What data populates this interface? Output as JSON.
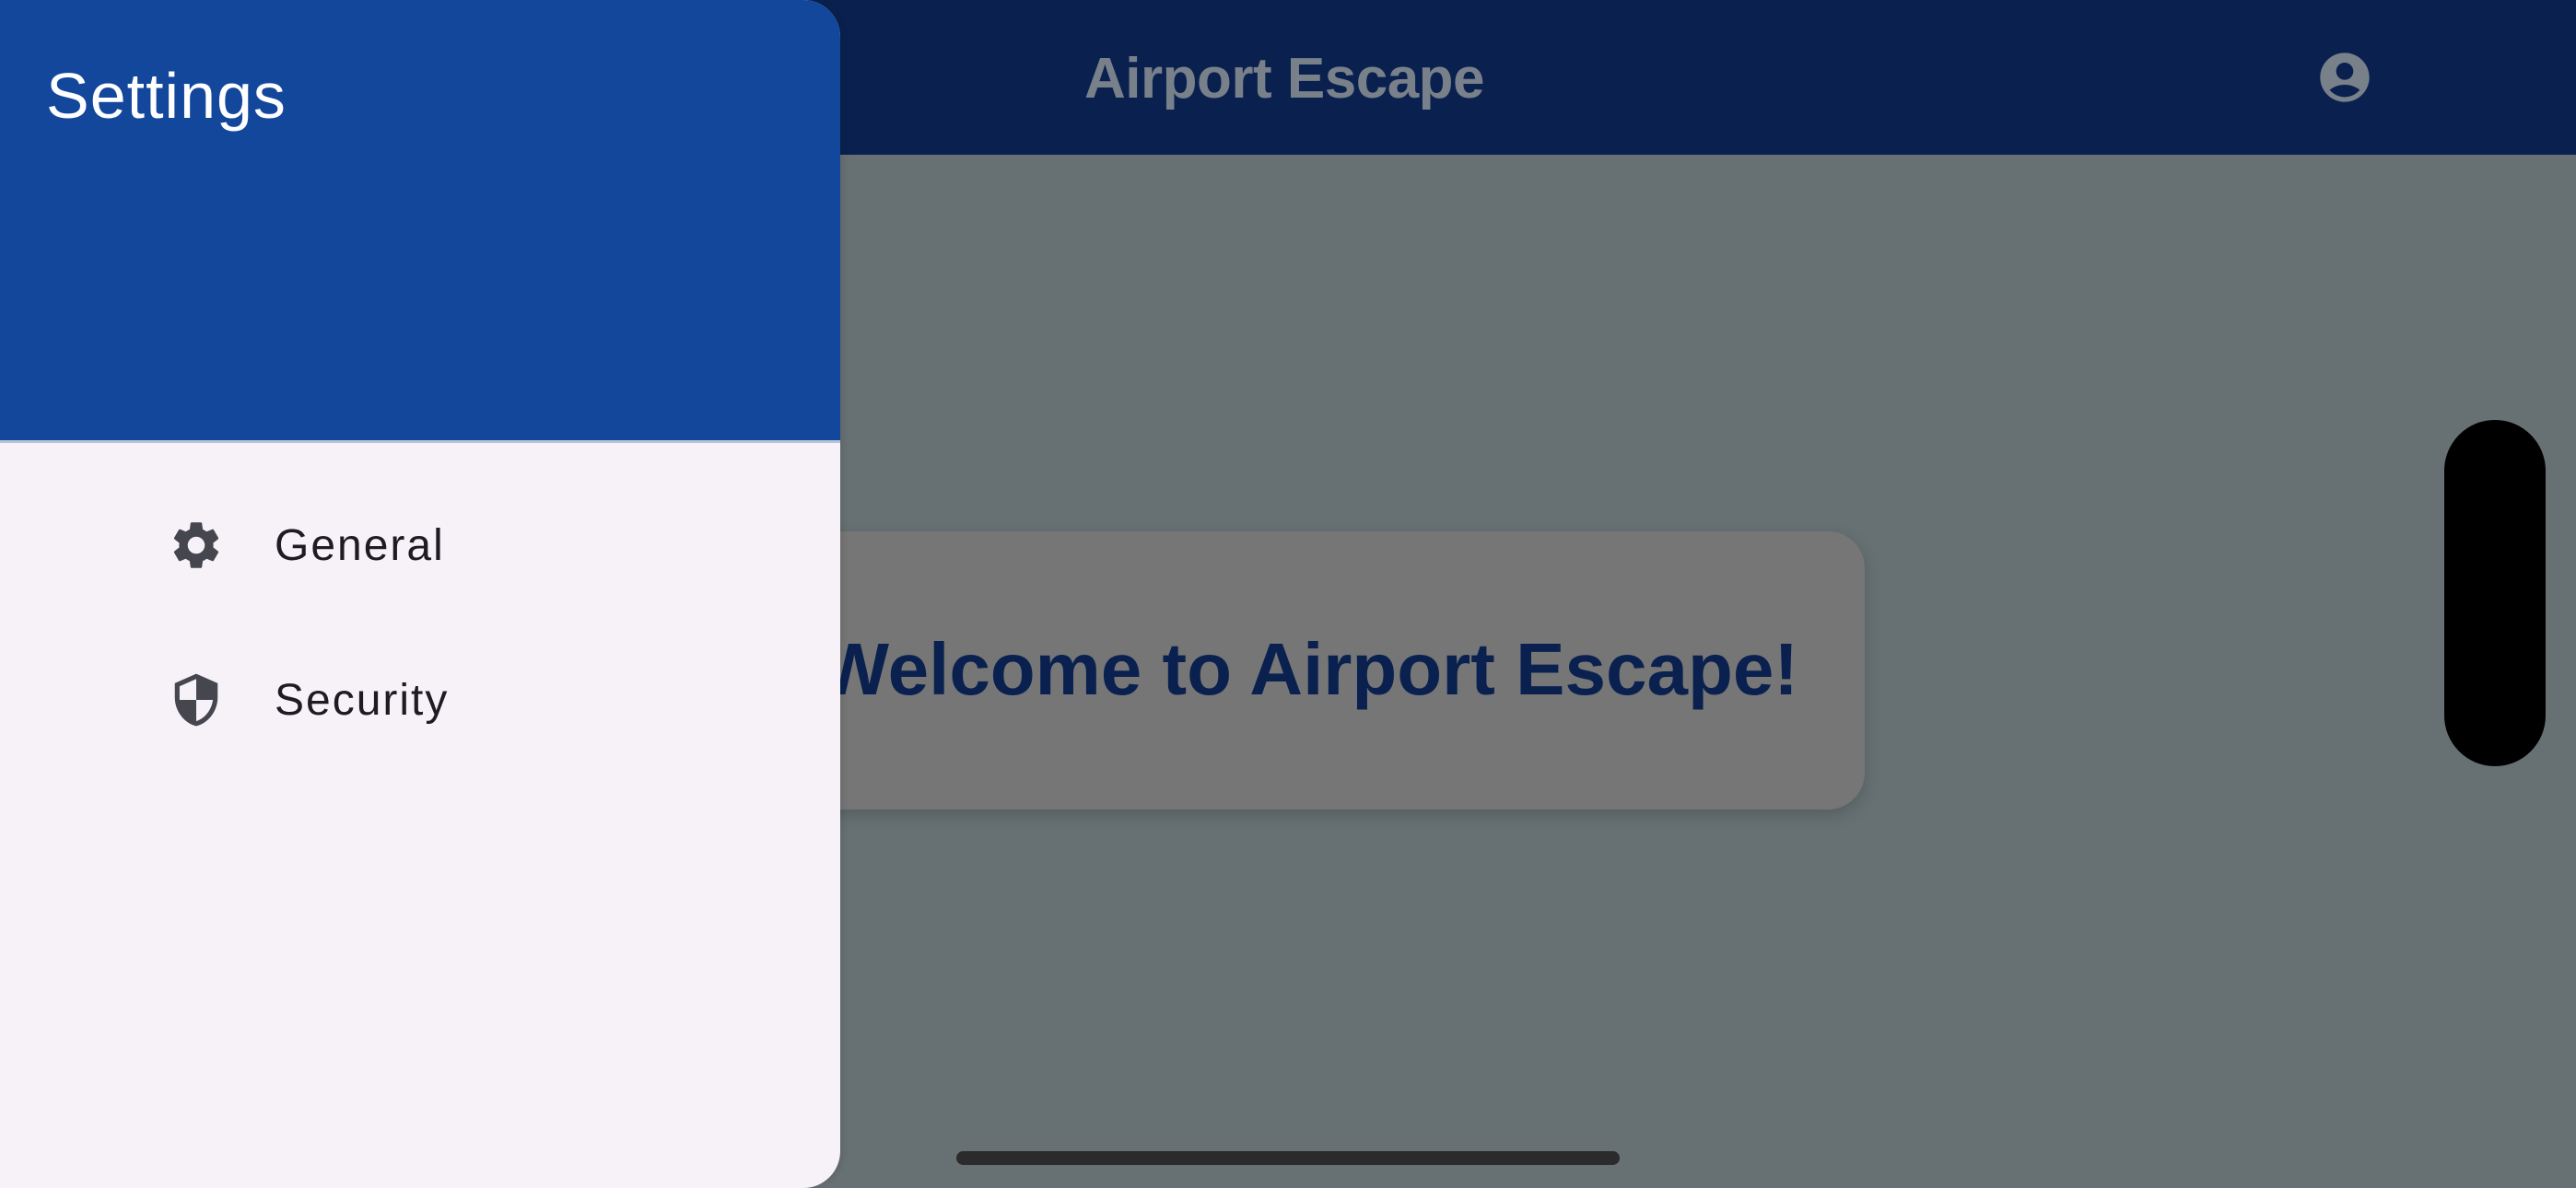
{
  "appbar": {
    "title": "Airport Escape",
    "account_icon": "account-circle-icon",
    "background_color": "#0a2150"
  },
  "main": {
    "welcome_text": "Welcome to Airport Escape!"
  },
  "drawer": {
    "title": "Settings",
    "header_color": "#13479c",
    "items": [
      {
        "label": "General",
        "icon": "gear-icon"
      },
      {
        "label": "Security",
        "icon": "shield-icon"
      }
    ]
  }
}
